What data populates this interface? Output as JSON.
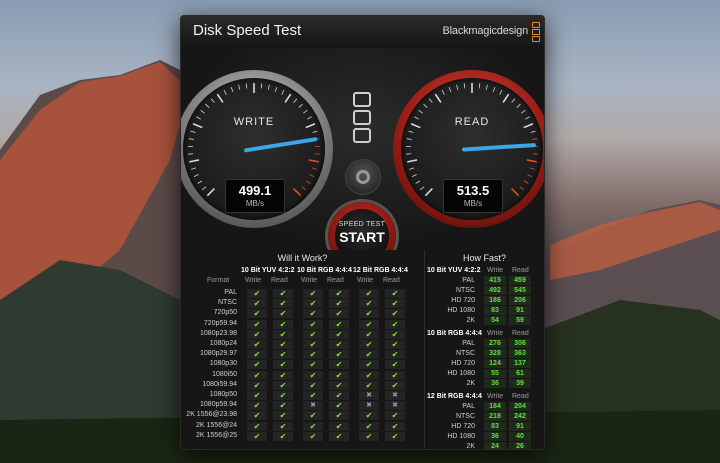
{
  "window": {
    "title": "Disk Speed Test",
    "brand": "Blackmagicdesign"
  },
  "write_gauge": {
    "label": "WRITE",
    "value": "499.1",
    "unit": "MB/s",
    "level": 0.8
  },
  "read_gauge": {
    "label": "READ",
    "value": "513.5",
    "unit": "MB/s",
    "level": 0.82
  },
  "start_button": {
    "line1": "SPEED TEST",
    "line2": "START"
  },
  "will_it_work": {
    "title": "Will it Work?",
    "groups": [
      "10 Bit YUV 4:2:2",
      "10 Bit RGB 4:4:4",
      "12 Bit RGB 4:4:4"
    ],
    "format_label": "Format",
    "col_write": "Write",
    "col_read": "Read",
    "rows": [
      {
        "format": "PAL",
        "cells": [
          1,
          1,
          1,
          1,
          1,
          1
        ]
      },
      {
        "format": "NTSC",
        "cells": [
          1,
          1,
          1,
          1,
          1,
          1
        ]
      },
      {
        "format": "720p50",
        "cells": [
          1,
          1,
          1,
          1,
          1,
          1
        ]
      },
      {
        "format": "720p59.94",
        "cells": [
          1,
          1,
          1,
          1,
          1,
          1
        ]
      },
      {
        "format": "1080p23.98",
        "cells": [
          1,
          1,
          1,
          1,
          1,
          1
        ]
      },
      {
        "format": "1080p24",
        "cells": [
          1,
          1,
          1,
          1,
          1,
          1
        ]
      },
      {
        "format": "1080p29.97",
        "cells": [
          1,
          1,
          1,
          1,
          1,
          1
        ]
      },
      {
        "format": "1080p30",
        "cells": [
          1,
          1,
          1,
          1,
          1,
          1
        ]
      },
      {
        "format": "1080i50",
        "cells": [
          1,
          1,
          1,
          1,
          1,
          1
        ]
      },
      {
        "format": "1080i59.94",
        "cells": [
          1,
          1,
          1,
          1,
          1,
          1
        ]
      },
      {
        "format": "1080p50",
        "cells": [
          1,
          1,
          1,
          1,
          0,
          0
        ]
      },
      {
        "format": "1080p59.94",
        "cells": [
          1,
          1,
          0,
          1,
          0,
          0
        ]
      },
      {
        "format": "2K 1556@23.98",
        "cells": [
          1,
          1,
          1,
          1,
          1,
          1
        ]
      },
      {
        "format": "2K 1556@24",
        "cells": [
          1,
          1,
          1,
          1,
          1,
          1
        ]
      },
      {
        "format": "2K 1556@25",
        "cells": [
          1,
          1,
          1,
          1,
          1,
          1
        ]
      }
    ]
  },
  "how_fast": {
    "title": "How Fast?",
    "col_write": "Write",
    "col_read": "Read",
    "groups": [
      {
        "name": "10 Bit YUV 4:2:2",
        "rows": [
          {
            "format": "PAL",
            "write": "415",
            "read": "459"
          },
          {
            "format": "NTSC",
            "write": "492",
            "read": "545"
          },
          {
            "format": "HD 720",
            "write": "186",
            "read": "206"
          },
          {
            "format": "HD 1080",
            "write": "83",
            "read": "91"
          },
          {
            "format": "2K",
            "write": "54",
            "read": "59"
          }
        ]
      },
      {
        "name": "10 Bit RGB 4:4:4",
        "rows": [
          {
            "format": "PAL",
            "write": "276",
            "read": "306"
          },
          {
            "format": "NTSC",
            "write": "328",
            "read": "363"
          },
          {
            "format": "HD 720",
            "write": "124",
            "read": "137"
          },
          {
            "format": "HD 1080",
            "write": "55",
            "read": "61"
          },
          {
            "format": "2K",
            "write": "36",
            "read": "39"
          }
        ]
      },
      {
        "name": "12 Bit RGB 4:4:4",
        "rows": [
          {
            "format": "PAL",
            "write": "184",
            "read": "204"
          },
          {
            "format": "NTSC",
            "write": "218",
            "read": "242"
          },
          {
            "format": "HD 720",
            "write": "83",
            "read": "91"
          },
          {
            "format": "HD 1080",
            "write": "36",
            "read": "40"
          },
          {
            "format": "2K",
            "write": "24",
            "read": "26"
          }
        ]
      }
    ]
  },
  "colors": {
    "accent_green": "#5fe03a",
    "needle_blue": "#3aa8e8",
    "start_red": "#c03025"
  },
  "icons": {
    "layout": "stacked-rectangles-icon",
    "settings": "gear-icon"
  }
}
